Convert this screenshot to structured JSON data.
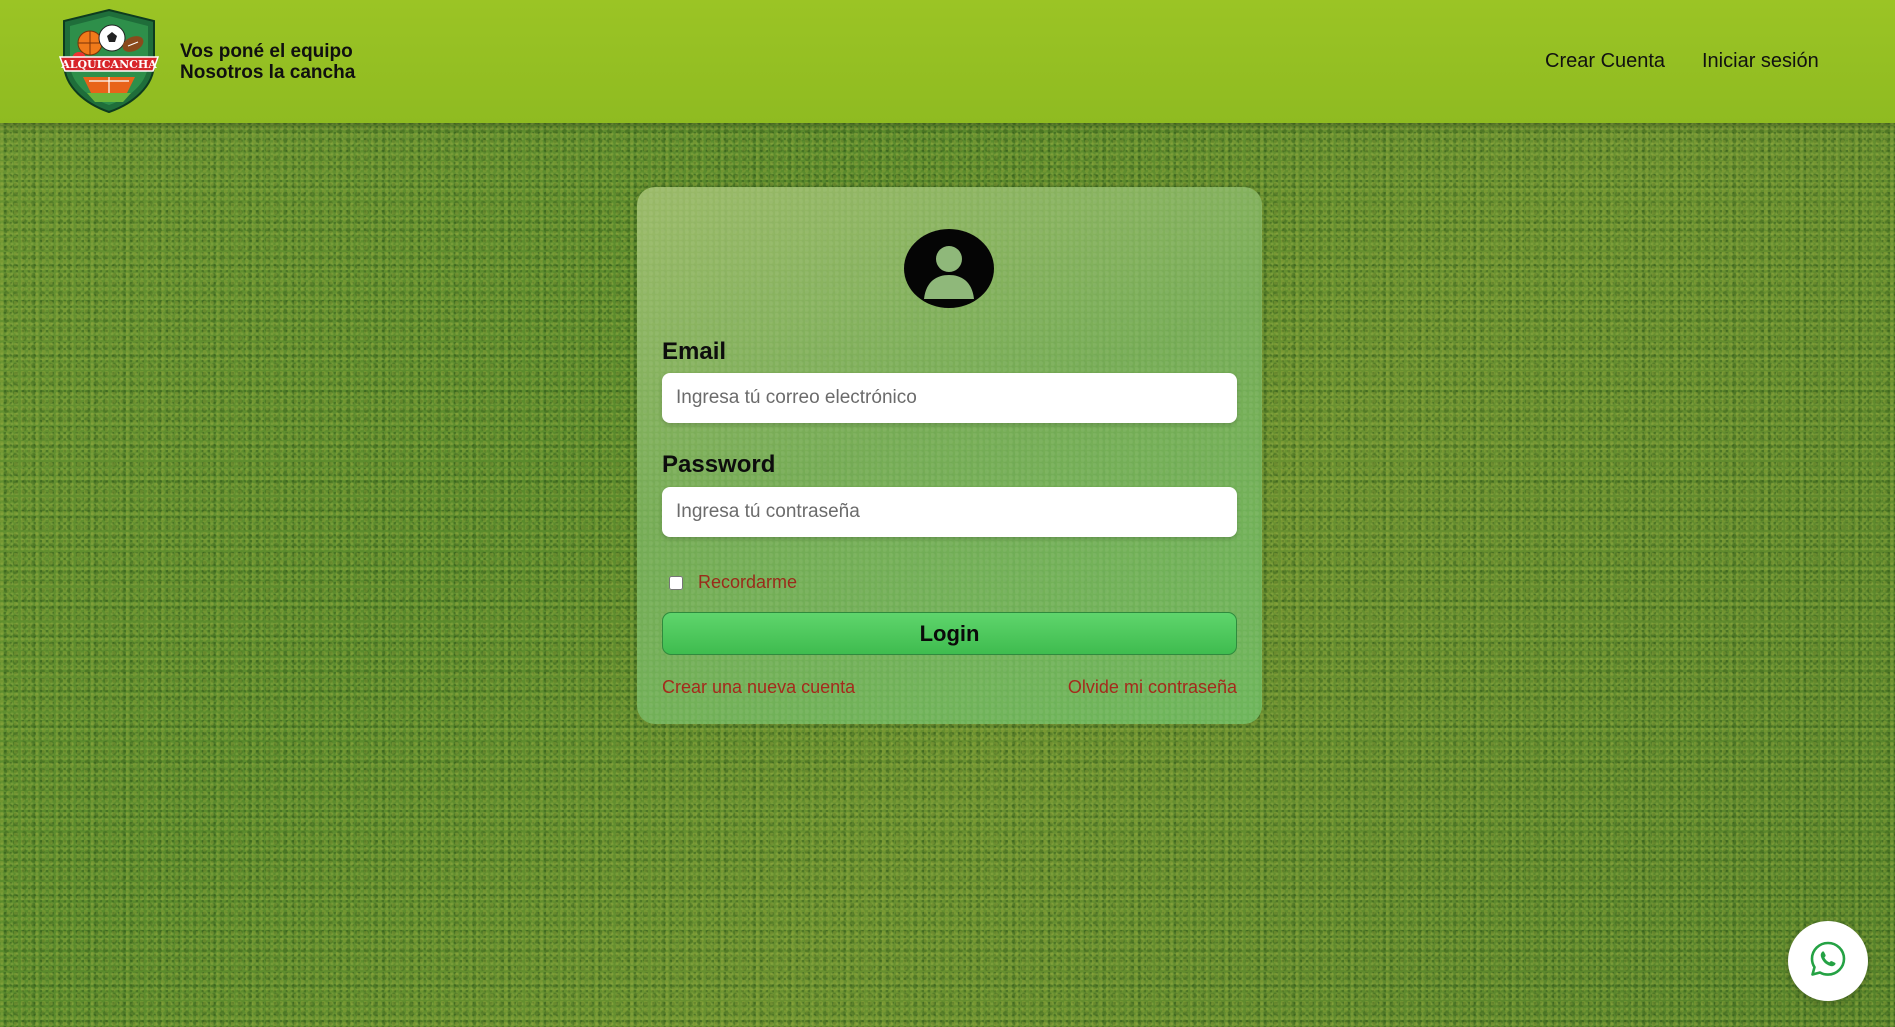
{
  "header": {
    "logo_text": "ALQUICANCHA",
    "tagline_line1": "Vos poné el equipo",
    "tagline_line2": "Nosotros la cancha",
    "nav": {
      "create_account": "Crear Cuenta",
      "login": "Iniciar sesión"
    }
  },
  "login_form": {
    "avatar_icon": "user-avatar-icon",
    "email_label": "Email",
    "email_placeholder": "Ingresa tú correo electrónico",
    "email_value": "",
    "password_label": "Password",
    "password_placeholder": "Ingresa tú contraseña",
    "password_value": "",
    "remember_label": "Recordarme",
    "remember_checked": false,
    "login_button": "Login",
    "create_account_link": "Crear una nueva cuenta",
    "forgot_password_link": "Olvide mi contraseña"
  },
  "floating": {
    "whatsapp_icon": "whatsapp-icon"
  },
  "colors": {
    "header_green": "#9bc425",
    "button_green": "#4cc85b",
    "link_red": "#a52a1c"
  }
}
